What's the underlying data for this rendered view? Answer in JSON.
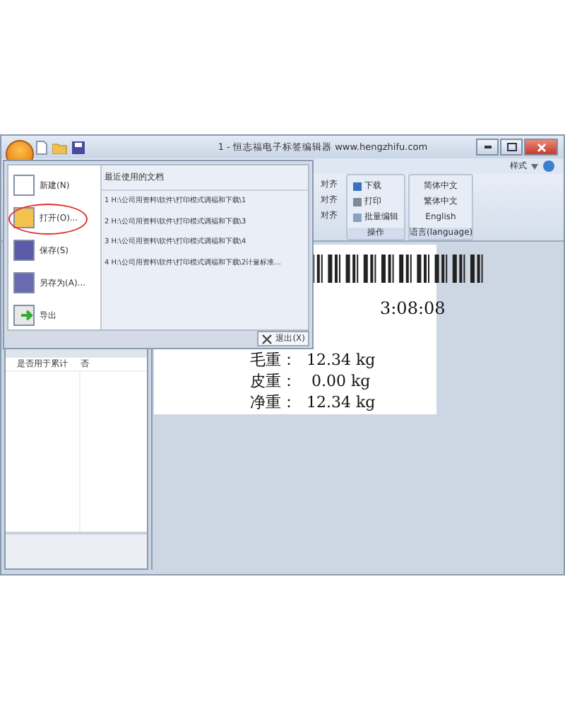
{
  "window": {
    "title": "1 - 恒志福电子标签编辑器 www.hengzhifu.com"
  },
  "ribbon": {
    "style_menu": "样式",
    "groups": [
      {
        "kind": "partial",
        "items": [
          "对齐",
          "对齐",
          "对齐"
        ]
      },
      {
        "kind": "actions",
        "label": "操作",
        "items": [
          "下载",
          "打印",
          "批量编辑"
        ]
      },
      {
        "kind": "language",
        "label": "语言(language)",
        "items": [
          "简体中文",
          "繁体中文",
          "English"
        ]
      }
    ]
  },
  "properties": {
    "rows": [
      {
        "name": "是否用于累计",
        "value": "否"
      }
    ]
  },
  "label": {
    "time": "3:08:08",
    "weights": [
      {
        "name": "毛重：",
        "value": "12.34 kg"
      },
      {
        "name": "皮重：",
        "value": " 0.00 kg"
      },
      {
        "name": "净重：",
        "value": "12.34 kg"
      }
    ]
  },
  "app_menu": {
    "items": [
      {
        "label": "新建(N)",
        "highlighted": false
      },
      {
        "label": "打开(O)...",
        "highlighted": true
      },
      {
        "label": "保存(S)",
        "highlighted": false
      },
      {
        "label": "另存为(A)...",
        "highlighted": false
      },
      {
        "label": "导出",
        "highlighted": false
      }
    ],
    "recent_title": "最近使用的文档",
    "recent": [
      "1 H:\\公司用资料\\软件\\打印模式调福和下载\\1",
      "2 H:\\公司用资料\\软件\\打印模式调福和下载\\3",
      "3 H:\\公司用资料\\软件\\打印模式调福和下载\\4",
      "4 H:\\公司用资料\\软件\\打印模式调福和下载\\2计量标准..."
    ],
    "exit": "退出(X)"
  }
}
